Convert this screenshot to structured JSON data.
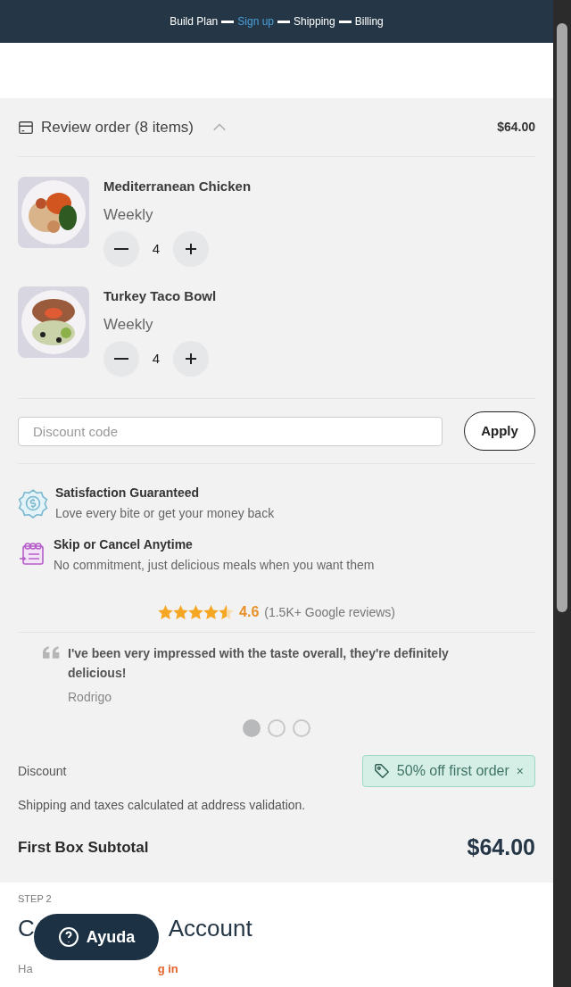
{
  "progress_steps": [
    {
      "label": "Build Plan",
      "selected": false
    },
    {
      "label": "Sign up",
      "selected": true
    },
    {
      "label": "Shipping",
      "selected": false
    },
    {
      "label": "Billing",
      "selected": false
    }
  ],
  "order": {
    "title": "Review order (8 items)",
    "expanded": true,
    "total": "$64.00",
    "items": [
      {
        "name": "Mediterranean Chicken",
        "frequency": "Weekly",
        "quantity": "4"
      },
      {
        "name": "Turkey Taco Bowl",
        "frequency": "Weekly",
        "quantity": "4"
      }
    ]
  },
  "discount_field": {
    "placeholder": "Discount code",
    "button": "Apply"
  },
  "benefits": [
    {
      "kind": "guarantee",
      "title": "Satisfaction Guaranteed",
      "text": "Love every bite or get your money back"
    },
    {
      "kind": "calendar",
      "title": "Skip or Cancel Anytime",
      "text": "No commitment, just delicious meals when you want them"
    }
  ],
  "rating": {
    "stars": 4.5,
    "score": "4.6",
    "count": "(1.5K+ Google reviews)"
  },
  "testimonial": {
    "quote": "I've been very impressed with the taste overall, they're definitely delicious!",
    "author": "Rodrigo",
    "dots": [
      {
        "selected": true
      },
      {
        "selected": false
      },
      {
        "selected": false
      }
    ]
  },
  "discount": {
    "label": "Discount",
    "tag": "50% off first order",
    "remove": "×"
  },
  "note": "Shipping and taxes calculated at address validation.",
  "subtotal": {
    "label": "First Box Subtotal",
    "value": "$64.00"
  },
  "step": {
    "label": "STEP 2",
    "heading_parts": [
      "C",
      "Account"
    ],
    "login_parts": [
      "Ha",
      "g in"
    ]
  },
  "help_button": "Ayuda"
}
